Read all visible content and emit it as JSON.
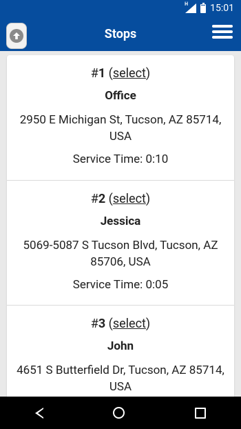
{
  "status_bar": {
    "time": "15:01",
    "network": "H"
  },
  "app_bar": {
    "title": "Stops"
  },
  "stops": [
    {
      "number": "1",
      "select_label": "select",
      "name": "Office",
      "address": "2950 E Michigan St, Tucson, AZ 85714, USA",
      "service_time": "Service Time: 0:10"
    },
    {
      "number": "2",
      "select_label": "select",
      "name": "Jessica",
      "address": "5069-5087 S Tucson Blvd, Tucson, AZ 85706, USA",
      "service_time": "Service Time: 0:05"
    },
    {
      "number": "3",
      "select_label": "select",
      "name": "John",
      "address": "4651 S Butterfield Dr, Tucson, AZ 85714, USA",
      "service_time": ""
    }
  ],
  "colors": {
    "app_bar": "#064d9e",
    "nav_bar": "#000000",
    "background": "#e9e9e9"
  },
  "icons": {
    "up": "arrow-up-circle-icon",
    "menu": "hamburger-menu-icon",
    "back": "back-triangle-icon",
    "home": "home-circle-icon",
    "recents": "recents-square-icon"
  }
}
